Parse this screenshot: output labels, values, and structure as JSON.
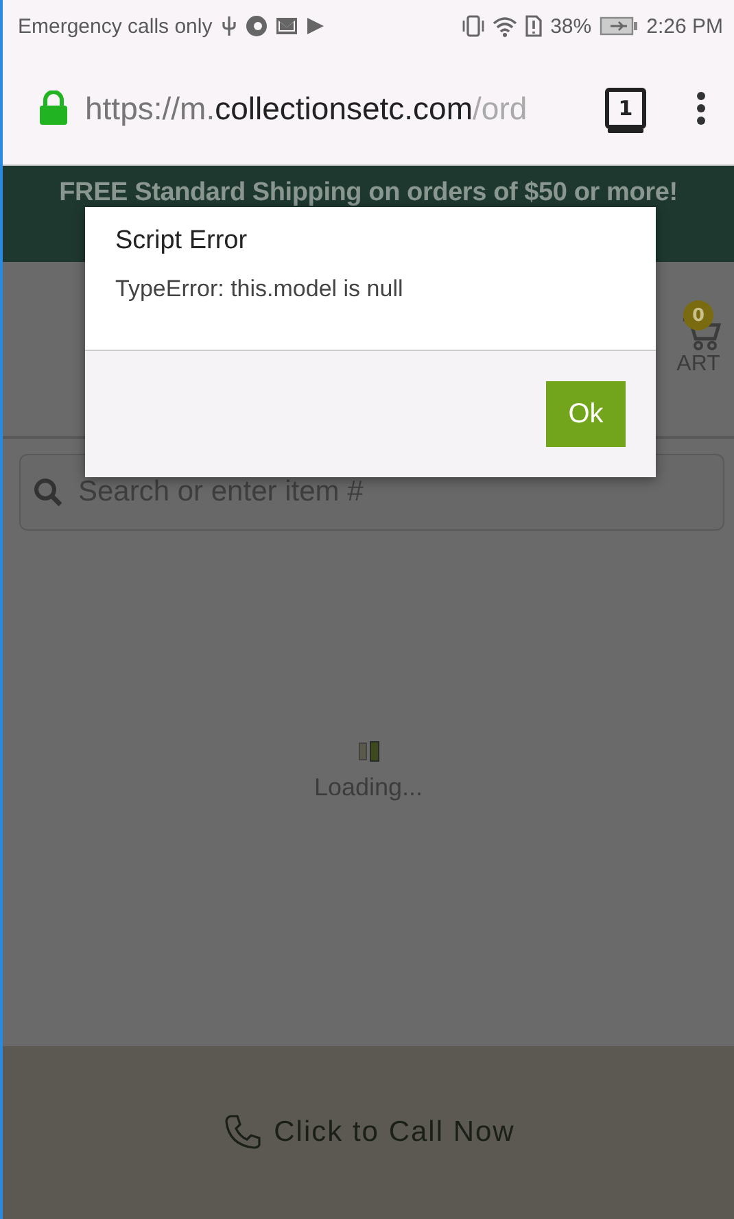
{
  "status_bar": {
    "carrier": "Emergency calls only",
    "battery": "38%",
    "time": "2:26 PM"
  },
  "browser": {
    "url_scheme": "https://m.",
    "url_host": "collectionsetc.com",
    "url_path": "/ord",
    "tab_count": "1",
    "secure": true
  },
  "banner": {
    "text": "FREE Standard Shipping on orders of $50 or more!"
  },
  "header": {
    "cart_count": "0",
    "cart_label": "ART"
  },
  "search": {
    "placeholder": "Search or enter item #"
  },
  "loading": {
    "text": "Loading..."
  },
  "footer": {
    "call_label": "Click to Call Now"
  },
  "dialog": {
    "title": "Script Error",
    "message": "TypeError: this.model is null",
    "buttons": [
      "Ok"
    ]
  }
}
